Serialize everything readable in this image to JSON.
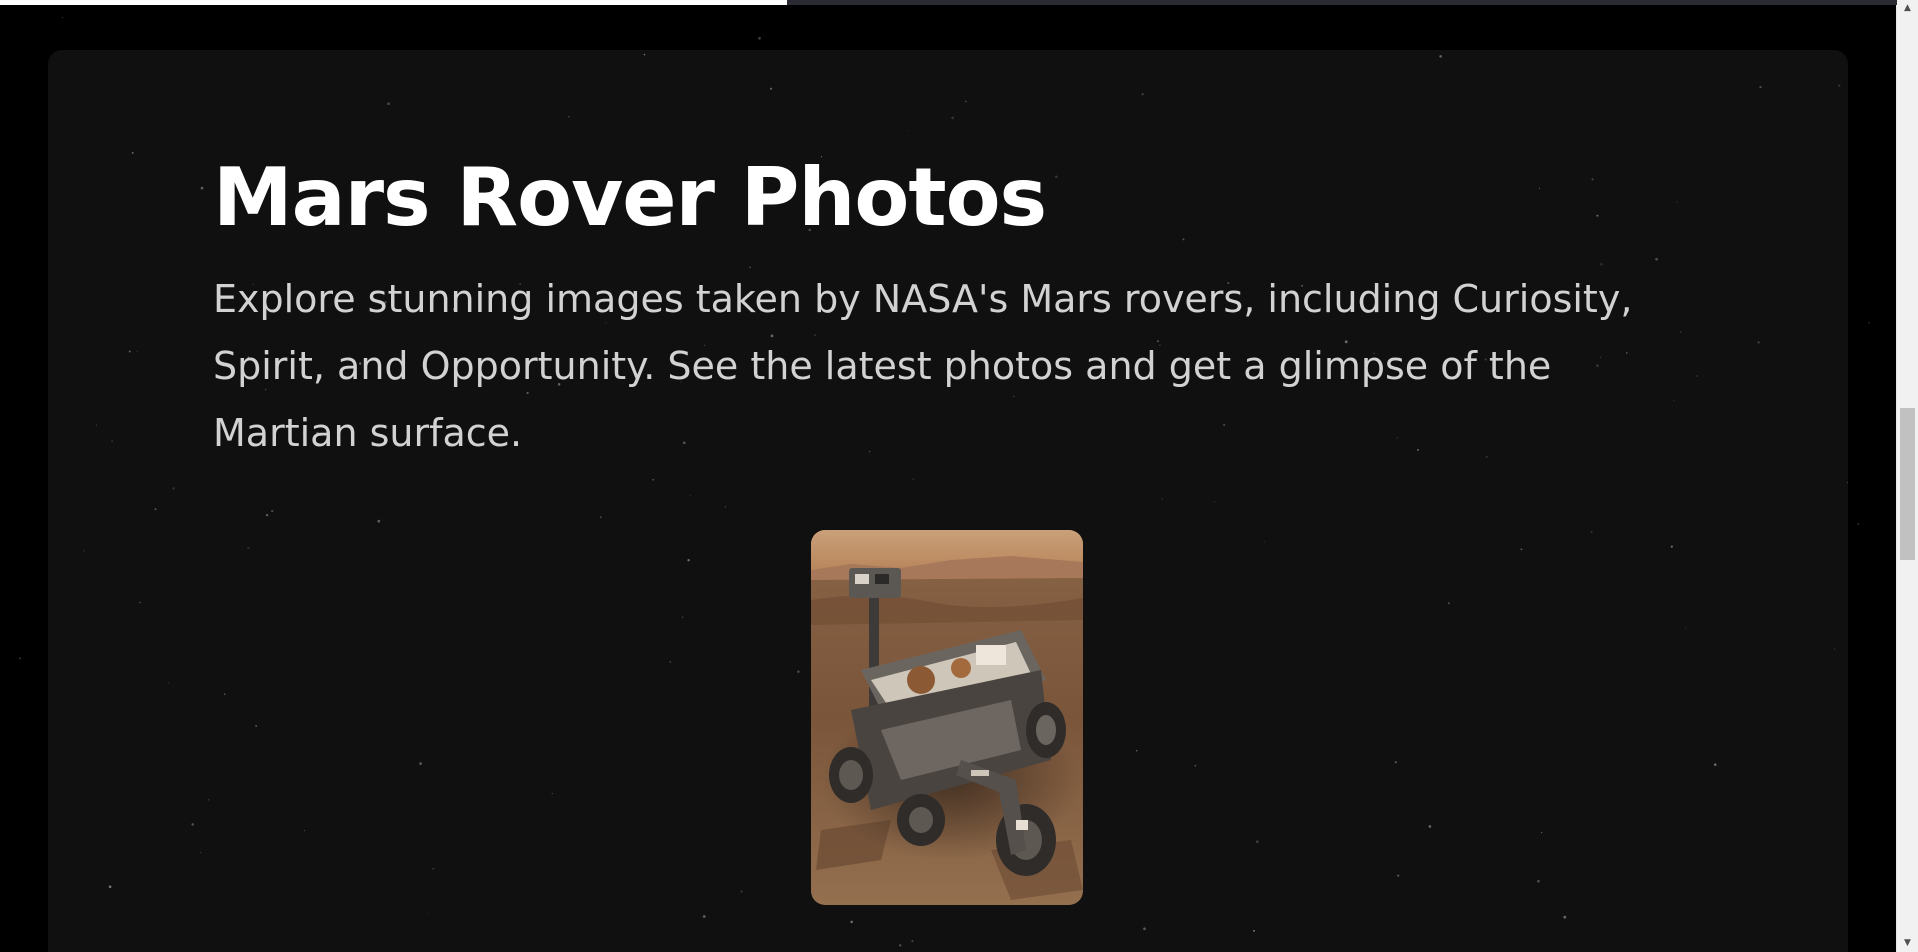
{
  "reading_progress": 0.415,
  "hero": {
    "title": "Mars Rover Photos",
    "description": "Explore stunning images taken by NASA's Mars rovers, including Curiosity, Spirit, and Opportunity. See the latest photos and get a glimpse of the Martian surface."
  },
  "photo": {
    "icon": "mars-rover-photo"
  },
  "scrollbar": {
    "up_arrow": "▲",
    "down_arrow": "▼"
  },
  "colors": {
    "page_background": "#000000",
    "card_background": "#101010",
    "title": "#ffffff",
    "description": "#d2d2d2",
    "progress_fill": "#ffffff"
  }
}
